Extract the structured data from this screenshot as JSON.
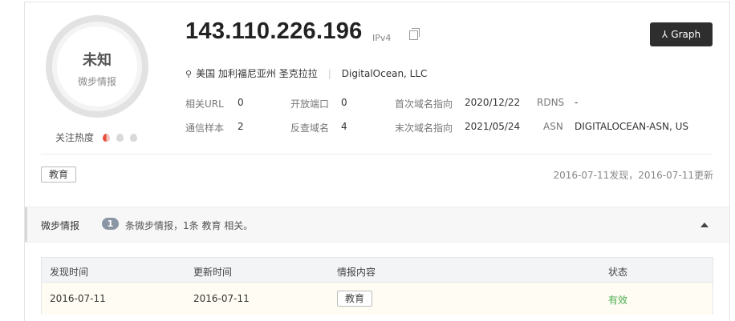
{
  "verdict": {
    "label": "未知",
    "source": "微步情报"
  },
  "heat": {
    "label": "关注热度",
    "level": 1,
    "max": 3
  },
  "ip": {
    "address": "143.110.226.196",
    "version": "IPv4"
  },
  "graph_button": {
    "label": "Graph"
  },
  "location": {
    "place": "美国 加利福尼亚州 圣克拉拉",
    "isp": "DigitalOcean, LLC"
  },
  "stats": {
    "related_url": {
      "label": "相关URL",
      "value": "0"
    },
    "open_ports": {
      "label": "开放端口",
      "value": "0"
    },
    "first_domain": {
      "label": "首次域名指向",
      "value": "2020/12/22"
    },
    "rdns": {
      "label": "RDNS",
      "value": "-"
    },
    "samples": {
      "label": "通信样本",
      "value": "2"
    },
    "reverse_domains": {
      "label": "反查域名",
      "value": "4"
    },
    "last_domain": {
      "label": "末次域名指向",
      "value": "2021/05/24"
    },
    "asn": {
      "label": "ASN",
      "value": "DIGITALOCEAN-ASN, US"
    }
  },
  "tags": [
    "教育"
  ],
  "dates_summary": "2016-07-11发现，2016-07-11更新",
  "intel_section": {
    "title": "微步情报",
    "count": "1",
    "description": "条微步情报，1条 教育 相关。"
  },
  "table": {
    "columns": [
      "发现时间",
      "更新时间",
      "情报内容",
      "状态"
    ],
    "rows": [
      {
        "found": "2016-07-11",
        "updated": "2016-07-11",
        "content": "教育",
        "status": "有效"
      }
    ]
  },
  "colors": {
    "status_valid": "#4caf50",
    "graph_button_bg": "#2e2e2e",
    "heat_on": "#e74c3c"
  }
}
